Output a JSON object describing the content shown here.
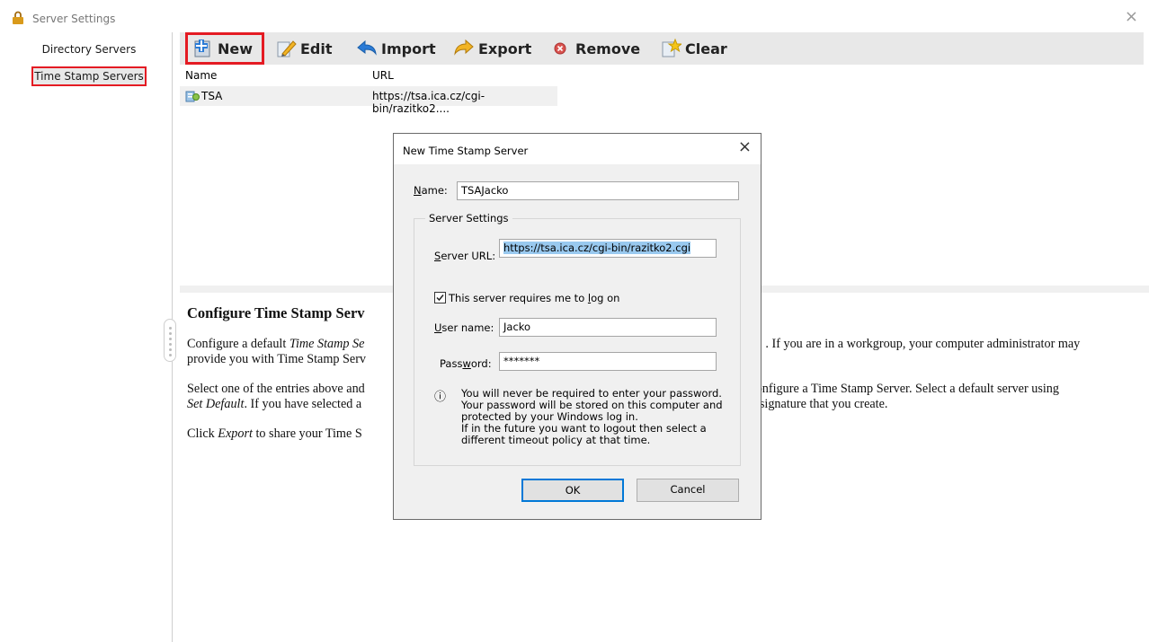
{
  "window": {
    "title": "Server Settings",
    "close_glyph": "×"
  },
  "sidebar": {
    "items": [
      {
        "label": "Directory Servers",
        "selected": false
      },
      {
        "label": "Time Stamp Servers",
        "selected": true
      }
    ]
  },
  "toolbar": {
    "new_label": "New",
    "edit_label": "Edit",
    "import_label": "Import",
    "export_label": "Export",
    "remove_label": "Remove",
    "clear_label": "Clear"
  },
  "list": {
    "columns": [
      "Name",
      "URL"
    ],
    "rows": [
      {
        "name": "TSA",
        "url": "https://tsa.ica.cz/cgi-bin/razitko2...."
      }
    ]
  },
  "help": {
    "heading": "Configure Time Stamp Serv",
    "p1_a": "Configure a default ",
    "p1_i": "Time Stamp Se",
    "p1_b": ". If you are in a workgroup, your computer administrator may",
    "p1_c": "provide you with Time Stamp Serv",
    "p2_a": "Select one of the entries above and",
    "p2_b": "d configure a Time Stamp Server. Select a default server using",
    "p2_i": "Set Default",
    "p2_c": ". If you have selected a",
    "p2_d": "y signature that you create.",
    "p3_a": "Click ",
    "p3_i": "Export",
    "p3_b": " to share your Time S"
  },
  "dialog": {
    "title": "New Time Stamp Server",
    "close_glyph": "×",
    "name_label_u": "N",
    "name_label_rest": "ame:",
    "name_value": "TSAJacko",
    "group_label": "Server Settings",
    "url_label_u": "S",
    "url_label_rest": "erver URL:",
    "url_value": "https://tsa.ica.cz/cgi-bin/razitko2.cgi",
    "logon_label_a": "This server requires me to ",
    "logon_label_u": "l",
    "logon_label_b": "og on",
    "logon_checked": true,
    "username_label_u": "U",
    "username_label_rest": "ser name:",
    "username_value": "Jacko",
    "password_label_a": "Pass",
    "password_label_u": "w",
    "password_label_b": "ord:",
    "password_value": "*******",
    "info_glyph": "ⓘ",
    "info_lines": [
      "You will never be required to enter your password.",
      "Your password will be stored on this computer and",
      "protected by your Windows log in.",
      "If in the future you want to logout then select a",
      "different timeout policy at that time."
    ],
    "ok_label": "OK",
    "cancel_label": "Cancel"
  },
  "colors": {
    "highlight_red": "#e41b23",
    "focus_blue": "#0078d7",
    "selection_blue": "#99c9ef"
  },
  "icons": [
    "lock-icon",
    "new-plus-icon",
    "edit-pencil-icon",
    "import-arrow-icon",
    "export-arrow-icon",
    "remove-x-icon",
    "clear-broom-icon",
    "server-icon",
    "info-icon"
  ]
}
